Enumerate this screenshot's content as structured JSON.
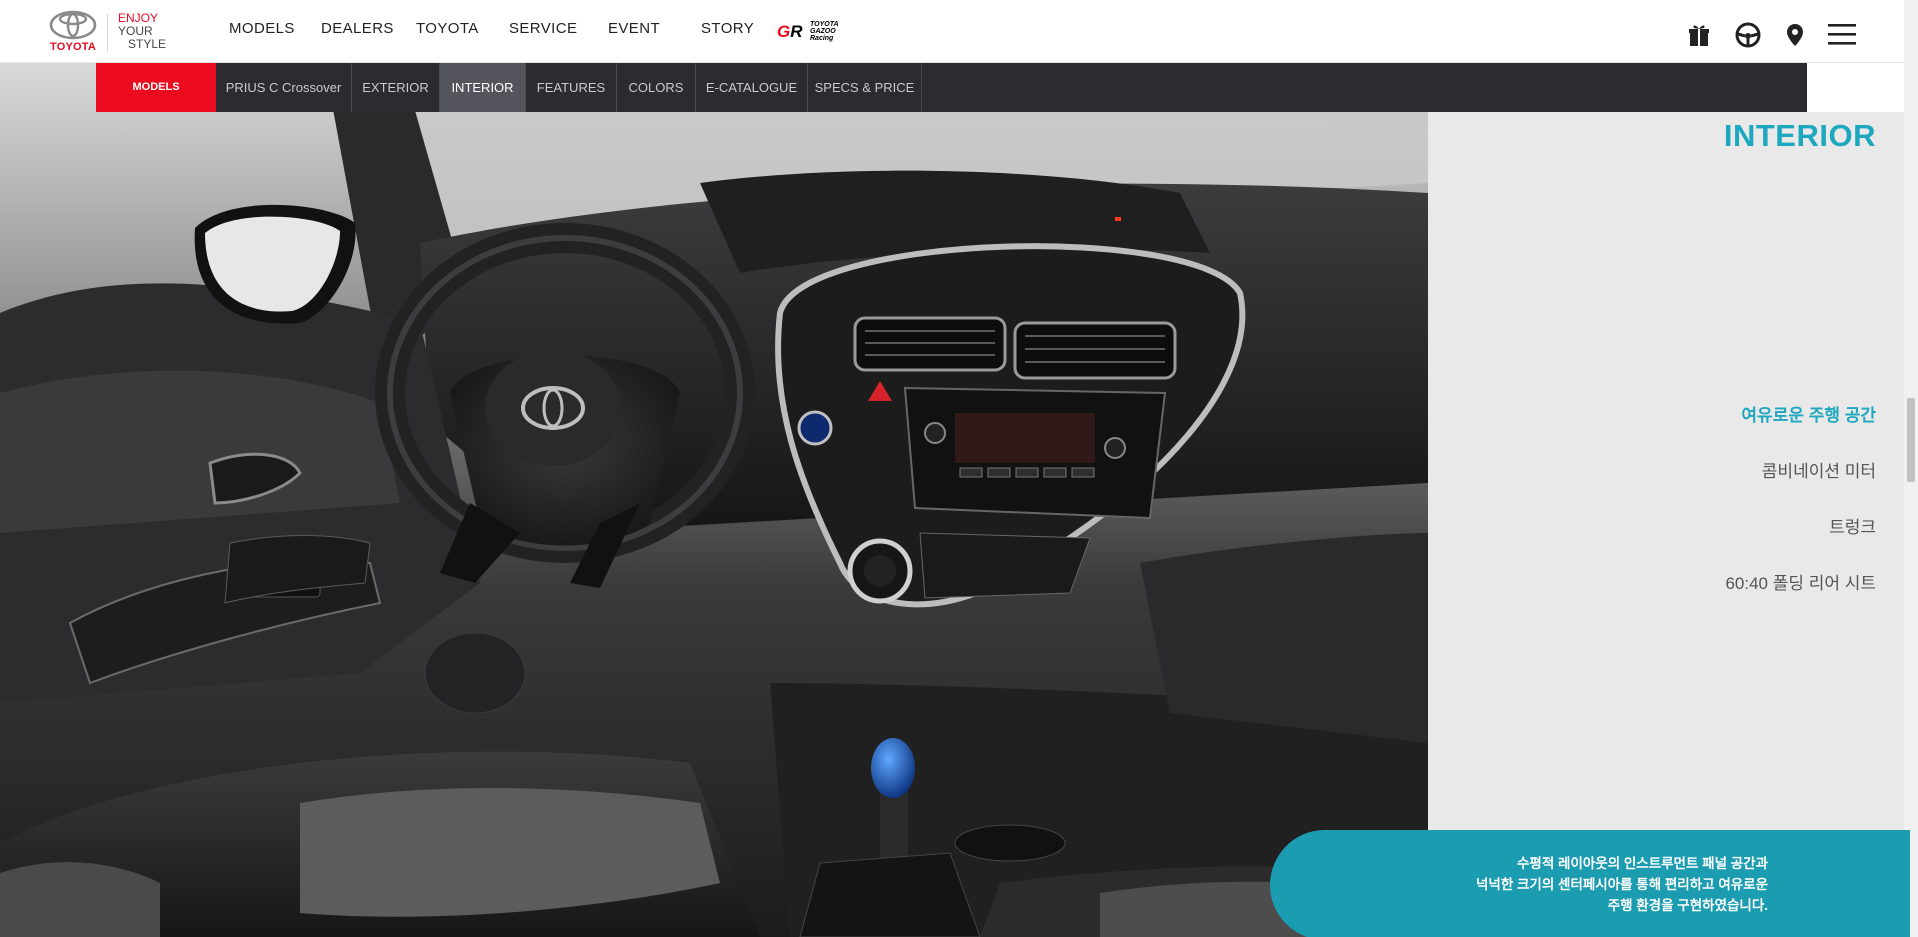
{
  "header": {
    "logo_text": "TOYOTA",
    "tagline": {
      "line1": "ENJOY",
      "line2": "YOUR",
      "line3": "STYLE"
    },
    "nav": [
      "MODELS",
      "DEALERS",
      "TOYOTA",
      "SERVICE",
      "EVENT",
      "STORY"
    ],
    "gr_logo": {
      "mark": "GR",
      "text": "TOYOTA GAZOO Racing"
    },
    "icons": [
      "gift-icon",
      "steering-wheel-icon",
      "location-pin-icon",
      "hamburger-menu-icon"
    ]
  },
  "subnav": {
    "models_label": "MODELS",
    "tabs": [
      "PRIUS C Crossover",
      "EXTERIOR",
      "INTERIOR",
      "FEATURES",
      "COLORS",
      "E-CATALOGUE",
      "SPECS & PRICE"
    ],
    "active_tab": "INTERIOR"
  },
  "side": {
    "title": "INTERIOR",
    "items": [
      "여유로운 주행 공간",
      "콤비네이션 미터",
      "트렁크",
      "60:40 폴딩 리어 시트"
    ],
    "active_item": "여유로운 주행 공간",
    "description": [
      "수평적 레이아웃의 인스트루먼트 패널 공간과",
      "넉넉한 크기의 센터페시아를 통해 편리하고 여유로운",
      "주행 환경을 구현하였습니다."
    ]
  },
  "colors": {
    "brand_red": "#eb0a1e",
    "accent_teal": "#1ea8c0",
    "subnav_bg": "#2b2b30"
  }
}
